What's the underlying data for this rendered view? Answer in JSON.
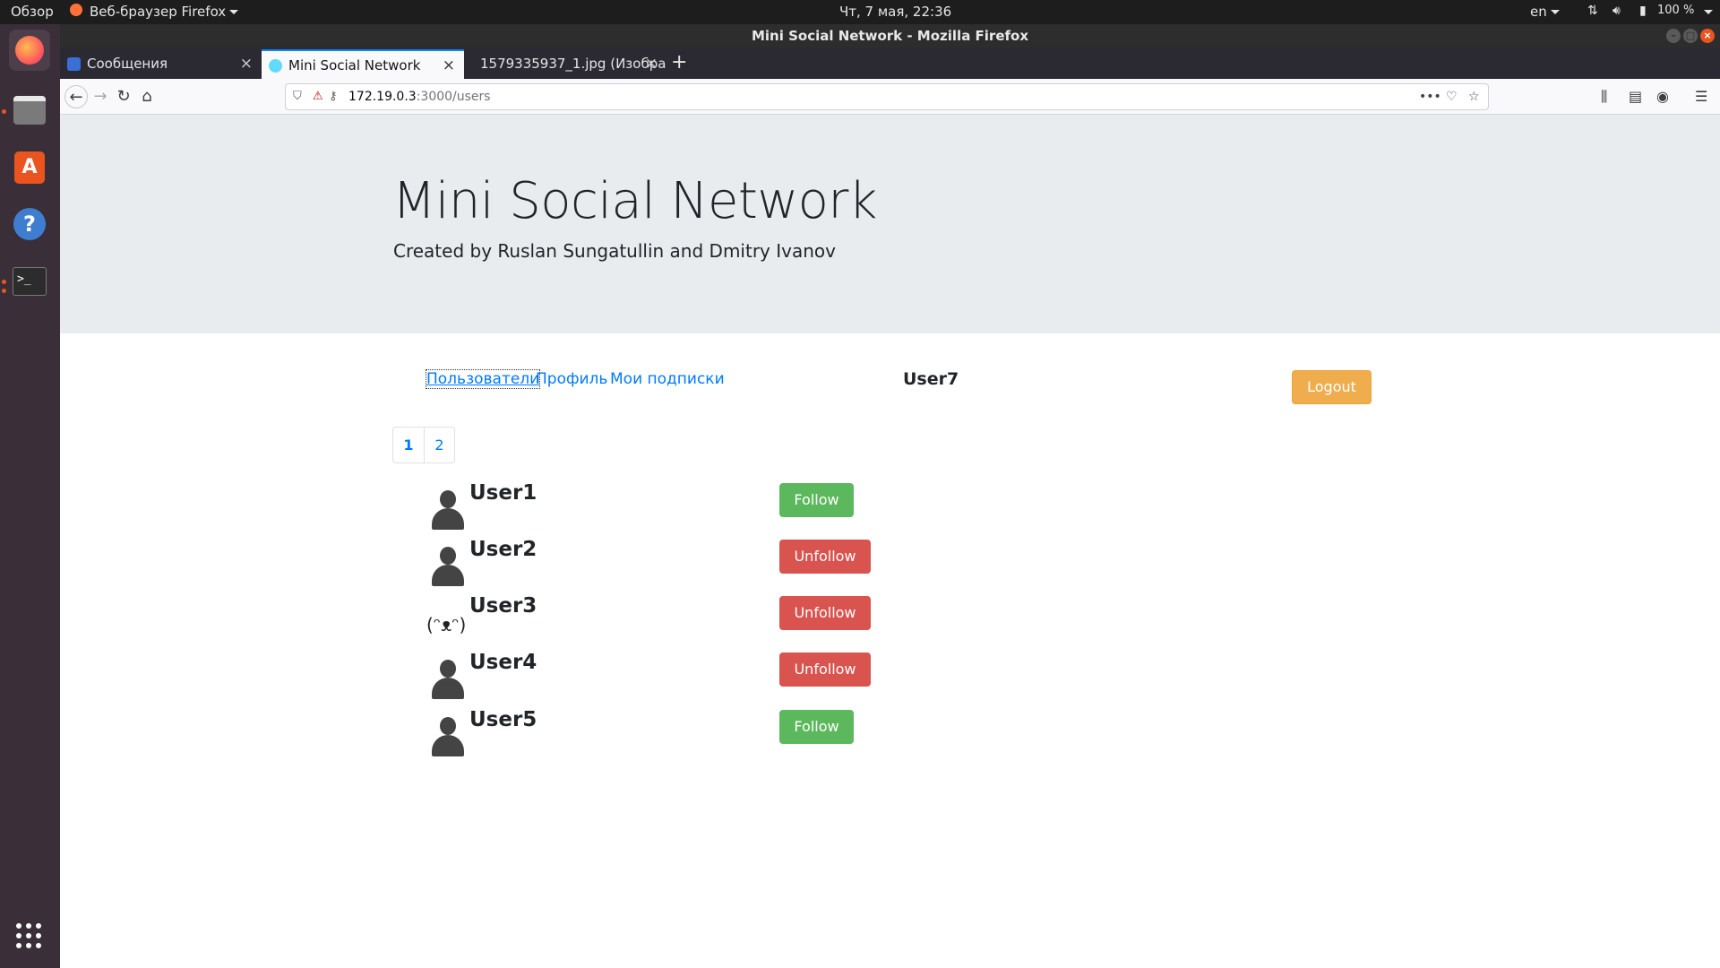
{
  "system_bar": {
    "activities": "Обзор",
    "app_menu": "Веб-браузер Firefox",
    "clock": "Чт, 7 мая, 22:36",
    "lang": "en",
    "battery": "100 %"
  },
  "window": {
    "title": "Mini Social Network - Mozilla Firefox"
  },
  "tabs": [
    {
      "label": "Сообщения"
    },
    {
      "label": "Mini Social Network"
    },
    {
      "label": "1579335937_1.jpg (Изобра"
    }
  ],
  "url": {
    "host": "172.19.0.3",
    "path": ":3000/users"
  },
  "header": {
    "title": "Mini Social Network",
    "subtitle": "Created by Ruslan Sungatullin and Dmitry Ivanov"
  },
  "nav": {
    "users": "Пользователи",
    "profile": "Профиль",
    "subscriptions": "Мои подписки",
    "current_user": "User7",
    "logout": "Logout"
  },
  "pagination": [
    "1",
    "2"
  ],
  "users": [
    {
      "name": "User1",
      "action": "Follow"
    },
    {
      "name": "User2",
      "action": "Unfollow"
    },
    {
      "name": "User3",
      "action": "Unfollow",
      "avatar_text": "(ᵔᴥᵔ)"
    },
    {
      "name": "User4",
      "action": "Unfollow"
    },
    {
      "name": "User5",
      "action": "Follow"
    }
  ],
  "colors": {
    "follow": "#5cb85c",
    "unfollow": "#d9534f",
    "logout": "#f0ad4e",
    "link": "#007bff"
  }
}
